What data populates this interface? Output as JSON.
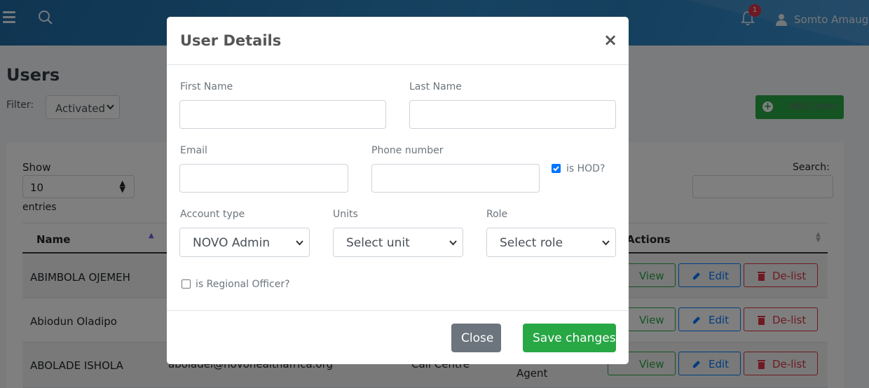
{
  "header": {
    "notifications_count": "1",
    "user_name": "Somto Amaugo"
  },
  "page": {
    "title": "Users",
    "filter_label": "Filter:",
    "filter_value": "Activated",
    "add_users_label": "Add Users"
  },
  "table": {
    "show_label": "Show",
    "show_value": "10",
    "entries_label": "entries",
    "search_label": "Search:",
    "columns": {
      "name": "Name",
      "actions": "Actions"
    },
    "rows": [
      {
        "name": "ABIMBOLA OJEMEH",
        "email": "",
        "unit": "",
        "role": ""
      },
      {
        "name": "Abiodun Oladipo",
        "email": "",
        "unit": "",
        "role": ""
      },
      {
        "name": "ABOLADE ISHOLA",
        "email": "aboladei@novohealthafrica.org",
        "unit": "Call Centre",
        "role": "Agent"
      }
    ],
    "actions": {
      "view": "View",
      "edit": "Edit",
      "delist": "De-list"
    }
  },
  "modal": {
    "title": "User Details",
    "close_icon": "×",
    "fields": {
      "first_name_label": "First Name",
      "last_name_label": "Last Name",
      "email_label": "Email",
      "phone_label": "Phone number",
      "is_hod_label": "is HOD?",
      "is_hod_checked": true,
      "account_type_label": "Account type",
      "account_type_value": "NOVO Admin",
      "units_label": "Units",
      "units_value": "Select unit",
      "role_label": "Role",
      "role_value": "Select role",
      "regional_officer_label": "is Regional Officer?",
      "regional_officer_checked": false
    },
    "footer": {
      "close_label": "Close",
      "save_label": "Save changes"
    }
  },
  "colors": {
    "primary_green": "#28a745",
    "primary_blue": "#007bff",
    "danger_red": "#dc3545",
    "secondary_gray": "#6c757d"
  }
}
